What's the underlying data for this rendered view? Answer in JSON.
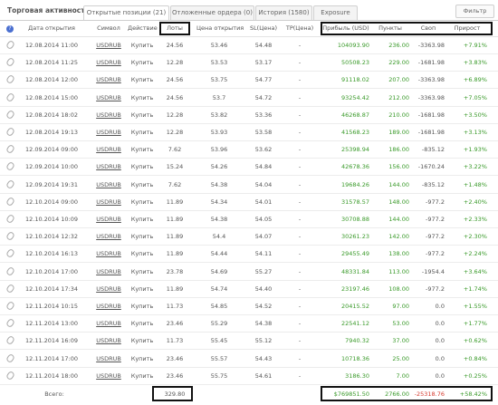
{
  "tabs": {
    "title": "Торговая активность",
    "items": [
      "Открытые позиции (21)",
      "Отложенные ордера (0)",
      "История (1580)",
      "Exposure"
    ],
    "filter_label": "Фильтр"
  },
  "columns": {
    "help": "?",
    "date": "Дата открытия",
    "symbol": "Символ",
    "action": "Действие",
    "lots": "Лоты",
    "open_price": "Цена открытия",
    "sl": "SL(Цена)",
    "tp": "TP(Цена)",
    "profit": "Прибыль (USD)",
    "points": "Пункты",
    "swap": "Своп",
    "growth": "Прирост"
  },
  "rows": [
    {
      "date": "12.08.2014 11:00",
      "symbol": "USDRUB",
      "action": "Купить",
      "lots": "24.56",
      "open": "53.46",
      "sl": "54.48",
      "tp": "-",
      "profit": "104093.90",
      "points": "236.00",
      "swap": "-3363.98",
      "growth": "+7.91%"
    },
    {
      "date": "12.08.2014 11:25",
      "symbol": "USDRUB",
      "action": "Купить",
      "lots": "12.28",
      "open": "53.53",
      "sl": "53.17",
      "tp": "-",
      "profit": "50508.23",
      "points": "229.00",
      "swap": "-1681.98",
      "growth": "+3.83%"
    },
    {
      "date": "12.08.2014 12:00",
      "symbol": "USDRUB",
      "action": "Купить",
      "lots": "24.56",
      "open": "53.75",
      "sl": "54.77",
      "tp": "-",
      "profit": "91118.02",
      "points": "207.00",
      "swap": "-3363.98",
      "growth": "+6.89%"
    },
    {
      "date": "12.08.2014 15:00",
      "symbol": "USDRUB",
      "action": "Купить",
      "lots": "24.56",
      "open": "53.7",
      "sl": "54.72",
      "tp": "-",
      "profit": "93254.42",
      "points": "212.00",
      "swap": "-3363.98",
      "growth": "+7.05%"
    },
    {
      "date": "12.08.2014 18:02",
      "symbol": "USDRUB",
      "action": "Купить",
      "lots": "12.28",
      "open": "53.82",
      "sl": "53.36",
      "tp": "-",
      "profit": "46268.87",
      "points": "210.00",
      "swap": "-1681.98",
      "growth": "+3.50%"
    },
    {
      "date": "12.08.2014 19:13",
      "symbol": "USDRUB",
      "action": "Купить",
      "lots": "12.28",
      "open": "53.93",
      "sl": "53.58",
      "tp": "-",
      "profit": "41568.23",
      "points": "189.00",
      "swap": "-1681.98",
      "growth": "+3.13%"
    },
    {
      "date": "12.09.2014 09:00",
      "symbol": "USDRUB",
      "action": "Купить",
      "lots": "7.62",
      "open": "53.96",
      "sl": "53.62",
      "tp": "-",
      "profit": "25398.94",
      "points": "186.00",
      "swap": "-835.12",
      "growth": "+1.93%"
    },
    {
      "date": "12.09.2014 10:00",
      "symbol": "USDRUB",
      "action": "Купить",
      "lots": "15.24",
      "open": "54.26",
      "sl": "54.84",
      "tp": "-",
      "profit": "42678.36",
      "points": "156.00",
      "swap": "-1670.24",
      "growth": "+3.22%"
    },
    {
      "date": "12.09.2014 19:31",
      "symbol": "USDRUB",
      "action": "Купить",
      "lots": "7.62",
      "open": "54.38",
      "sl": "54.04",
      "tp": "-",
      "profit": "19684.26",
      "points": "144.00",
      "swap": "-835.12",
      "growth": "+1.48%"
    },
    {
      "date": "12.10.2014 09:00",
      "symbol": "USDRUB",
      "action": "Купить",
      "lots": "11.89",
      "open": "54.34",
      "sl": "54.01",
      "tp": "-",
      "profit": "31578.57",
      "points": "148.00",
      "swap": "-977.2",
      "growth": "+2.40%"
    },
    {
      "date": "12.10.2014 10:09",
      "symbol": "USDRUB",
      "action": "Купить",
      "lots": "11.89",
      "open": "54.38",
      "sl": "54.05",
      "tp": "-",
      "profit": "30708.88",
      "points": "144.00",
      "swap": "-977.2",
      "growth": "+2.33%"
    },
    {
      "date": "12.10.2014 12:32",
      "symbol": "USDRUB",
      "action": "Купить",
      "lots": "11.89",
      "open": "54.4",
      "sl": "54.07",
      "tp": "-",
      "profit": "30261.23",
      "points": "142.00",
      "swap": "-977.2",
      "growth": "+2.30%"
    },
    {
      "date": "12.10.2014 16:13",
      "symbol": "USDRUB",
      "action": "Купить",
      "lots": "11.89",
      "open": "54.44",
      "sl": "54.11",
      "tp": "-",
      "profit": "29455.49",
      "points": "138.00",
      "swap": "-977.2",
      "growth": "+2.24%"
    },
    {
      "date": "12.10.2014 17:00",
      "symbol": "USDRUB",
      "action": "Купить",
      "lots": "23.78",
      "open": "54.69",
      "sl": "55.27",
      "tp": "-",
      "profit": "48331.84",
      "points": "113.00",
      "swap": "-1954.4",
      "growth": "+3.64%"
    },
    {
      "date": "12.10.2014 17:34",
      "symbol": "USDRUB",
      "action": "Купить",
      "lots": "11.89",
      "open": "54.74",
      "sl": "54.40",
      "tp": "-",
      "profit": "23197.46",
      "points": "108.00",
      "swap": "-977.2",
      "growth": "+1.74%"
    },
    {
      "date": "12.11.2014 10:15",
      "symbol": "USDRUB",
      "action": "Купить",
      "lots": "11.73",
      "open": "54.85",
      "sl": "54.52",
      "tp": "-",
      "profit": "20415.52",
      "points": "97.00",
      "swap": "0.0",
      "growth": "+1.55%"
    },
    {
      "date": "12.11.2014 13:00",
      "symbol": "USDRUB",
      "action": "Купить",
      "lots": "23.46",
      "open": "55.29",
      "sl": "54.38",
      "tp": "-",
      "profit": "22541.12",
      "points": "53.00",
      "swap": "0.0",
      "growth": "+1.77%"
    },
    {
      "date": "12.11.2014 16:09",
      "symbol": "USDRUB",
      "action": "Купить",
      "lots": "11.73",
      "open": "55.45",
      "sl": "55.12",
      "tp": "-",
      "profit": "7940.32",
      "points": "37.00",
      "swap": "0.0",
      "growth": "+0.62%"
    },
    {
      "date": "12.11.2014 17:00",
      "symbol": "USDRUB",
      "action": "Купить",
      "lots": "23.46",
      "open": "55.57",
      "sl": "54.43",
      "tp": "-",
      "profit": "10718.36",
      "points": "25.00",
      "swap": "0.0",
      "growth": "+0.84%"
    },
    {
      "date": "12.11.2014 18:00",
      "symbol": "USDRUB",
      "action": "Купить",
      "lots": "23.46",
      "open": "55.75",
      "sl": "54.61",
      "tp": "-",
      "profit": "3186.30",
      "points": "7.00",
      "swap": "0.0",
      "growth": "+0.25%"
    }
  ],
  "footer": {
    "label": "Всего:",
    "lots": "329.80",
    "profit": "$769851.50",
    "points": "2766.00",
    "swap": "-25318.76",
    "growth": "+58.42%"
  },
  "colors": {
    "positive": "#3a9a2a",
    "negative": "#d63b2f"
  }
}
